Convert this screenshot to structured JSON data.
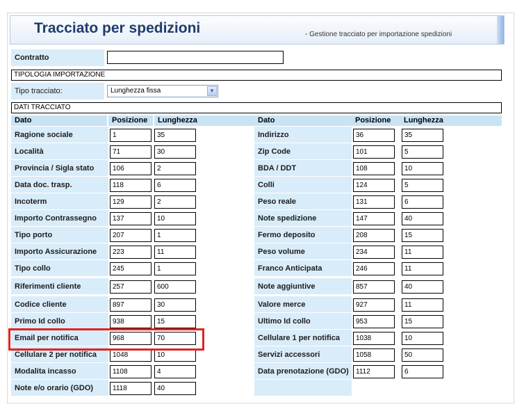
{
  "header": {
    "title": "Tracciato per spedizioni",
    "subtitle": "- Gestione tracciato per importazione spedizioni"
  },
  "contract": {
    "label": "Contratto",
    "value": ""
  },
  "import_section": {
    "title": "TIPOLOGIA IMPORTAZIONE",
    "type_label": "Tipo tracciato:",
    "type_value": "Lunghezza fissa"
  },
  "data_section": {
    "title": "DATI TRACCIATO",
    "columns": [
      "Dato",
      "Posizione",
      "Lunghezza",
      "Dato",
      "Posizione",
      "Lunghezza"
    ]
  },
  "rows": [
    {
      "left": {
        "name": "Ragione sociale",
        "pos": "1",
        "len": "35"
      },
      "right": {
        "name": "Indirizzo",
        "pos": "36",
        "len": "35"
      }
    },
    {
      "left": {
        "name": "Località",
        "pos": "71",
        "len": "30"
      },
      "right": {
        "name": "Zip Code",
        "pos": "101",
        "len": "5"
      }
    },
    {
      "left": {
        "name": "Provincia / Sigla stato",
        "pos": "106",
        "len": "2"
      },
      "right": {
        "name": "BDA / DDT",
        "pos": "108",
        "len": "10"
      }
    },
    {
      "left": {
        "name": "Data doc. trasp.",
        "pos": "118",
        "len": "6"
      },
      "right": {
        "name": "Colli",
        "pos": "124",
        "len": "5"
      }
    },
    {
      "left": {
        "name": "Incoterm",
        "pos": "129",
        "len": "2"
      },
      "right": {
        "name": "Peso reale",
        "pos": "131",
        "len": "6"
      }
    },
    {
      "left": {
        "name": "Importo Contrassegno",
        "pos": "137",
        "len": "10"
      },
      "right": {
        "name": "Note spedizione",
        "pos": "147",
        "len": "40"
      }
    },
    {
      "left": {
        "name": "Tipo porto",
        "pos": "207",
        "len": "1"
      },
      "right": {
        "name": "Fermo deposito",
        "pos": "208",
        "len": "15"
      }
    },
    {
      "left": {
        "name": "Importo Assicurazione",
        "pos": "223",
        "len": "11"
      },
      "right": {
        "name": "Peso volume",
        "pos": "234",
        "len": "11"
      }
    },
    {
      "left": {
        "name": "Tipo collo",
        "pos": "245",
        "len": "1"
      },
      "right": {
        "name": "Franco Anticipata",
        "pos": "246",
        "len": "11"
      }
    },
    {
      "left": {
        "name": "Riferimenti cliente",
        "pos": "257",
        "len": "600"
      },
      "right": {
        "name": "Note aggiuntive",
        "pos": "857",
        "len": "40"
      }
    },
    {
      "left": {
        "name": "Codice cliente",
        "pos": "897",
        "len": "30"
      },
      "right": {
        "name": "Valore merce",
        "pos": "927",
        "len": "11"
      }
    },
    {
      "left": {
        "name": "Primo Id collo",
        "pos": "938",
        "len": "15"
      },
      "right": {
        "name": "Ultimo Id collo",
        "pos": "953",
        "len": "15"
      }
    },
    {
      "left": {
        "name": "Email per notifica",
        "pos": "968",
        "len": "70"
      },
      "right": {
        "name": "Cellulare 1 per notifica",
        "pos": "1038",
        "len": "10"
      }
    },
    {
      "left": {
        "name": "Cellulare 2 per notifica",
        "pos": "1048",
        "len": "10"
      },
      "right": {
        "name": "Servizi accessori",
        "pos": "1058",
        "len": "50"
      }
    },
    {
      "left": {
        "name": "Modalita incasso",
        "pos": "1108",
        "len": "4"
      },
      "right": {
        "name": "Data prenotazione (GDO)",
        "pos": "1112",
        "len": "6"
      }
    },
    {
      "left": {
        "name": "Note e/o orario (GDO)",
        "pos": "1118",
        "len": "40"
      },
      "right": null
    }
  ]
}
